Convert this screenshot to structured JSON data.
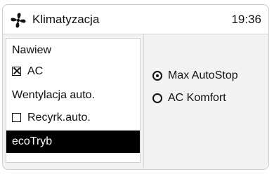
{
  "header": {
    "title": "Klimatyzacja",
    "time": "19:36",
    "icon": "fan-icon"
  },
  "left_menu": {
    "items": [
      {
        "label": "Nawiew",
        "type": "item",
        "selected": false
      },
      {
        "label": "AC",
        "type": "checkbox",
        "checked": true,
        "selected": false
      },
      {
        "label": "Wentylacja auto.",
        "type": "item",
        "selected": false
      },
      {
        "label": "Recyrk.auto.",
        "type": "checkbox",
        "checked": false,
        "selected": false
      },
      {
        "label": "ecoTryb",
        "type": "item",
        "selected": true
      }
    ]
  },
  "right_options": {
    "items": [
      {
        "label": "Max AutoStop",
        "selected": true
      },
      {
        "label": "AC Komfort",
        "selected": false
      }
    ]
  },
  "colors": {
    "selected_background": "#000000",
    "selected_text": "#ffffff"
  }
}
